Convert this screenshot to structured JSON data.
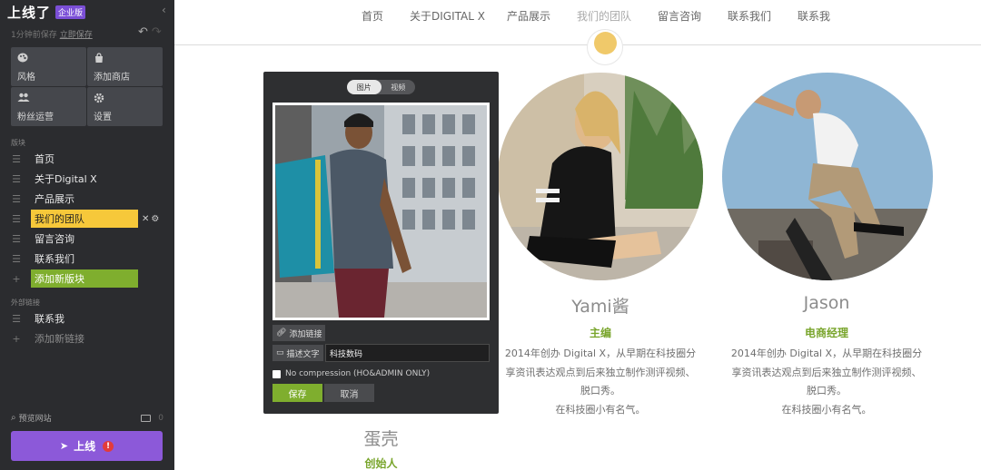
{
  "sidebar": {
    "logo": "上线了",
    "badge": "企业版",
    "collapse_icon": "chevron-left-icon",
    "save_status": "1分钟前保存",
    "save_now": "立即保存",
    "tiles": [
      {
        "label": "风格",
        "icon": "palette-icon"
      },
      {
        "label": "添加商店",
        "icon": "store-icon"
      },
      {
        "label": "粉丝运营",
        "icon": "users-icon"
      },
      {
        "label": "设置",
        "icon": "gear-icon"
      }
    ],
    "section_blocks": "版块",
    "nav_items": [
      {
        "label": "首页"
      },
      {
        "label": "关于Digital X"
      },
      {
        "label": "产品展示"
      },
      {
        "label": "我们的团队",
        "active": true
      },
      {
        "label": "留言咨询"
      },
      {
        "label": "联系我们"
      }
    ],
    "add_block": "添加新版块",
    "section_links": "外部链接",
    "link_items": [
      {
        "label": "联系我"
      }
    ],
    "add_link": "添加新链接",
    "preview": "预览网站",
    "preview_count": "0",
    "publish": "上线",
    "publish_warning": "!"
  },
  "topnav": {
    "items": [
      "首页",
      "关于DIGITAL X",
      "产品展示",
      "我们的团队",
      "留言咨询",
      "联系我们",
      "联系我"
    ],
    "current_index": 3
  },
  "team": {
    "members": [
      {
        "name": "蛋壳",
        "role": "创始人"
      },
      {
        "name": "Yami酱",
        "role": "主编",
        "desc": [
          "2014年创办 Digital X，从早期在科技圈分",
          "享资讯表达观点到后来独立制作测评视频、",
          "脱口秀。",
          "在科技圈小有名气。"
        ]
      },
      {
        "name": "Jason",
        "role": "电商经理",
        "desc": [
          "2014年创办 Digital X，从早期在科技圈分",
          "享资讯表达观点到后来独立制作测评视频、",
          "脱口秀。",
          "在科技圈小有名气。"
        ]
      }
    ]
  },
  "editor": {
    "tab_image": "图片",
    "tab_video": "视频",
    "add_link": "添加链接",
    "describe_label": "描述文字",
    "describe_value": "科技数码",
    "no_compression": "No compression (HO&ADMIN ONLY)",
    "save": "保存",
    "cancel": "取消"
  },
  "colors": {
    "sidebar_bg": "#2b2c2f",
    "accent_green": "#7fae2e",
    "active_yellow": "#f6c83a",
    "publish_purple": "#8c59d9",
    "role_green": "#79a52c"
  }
}
